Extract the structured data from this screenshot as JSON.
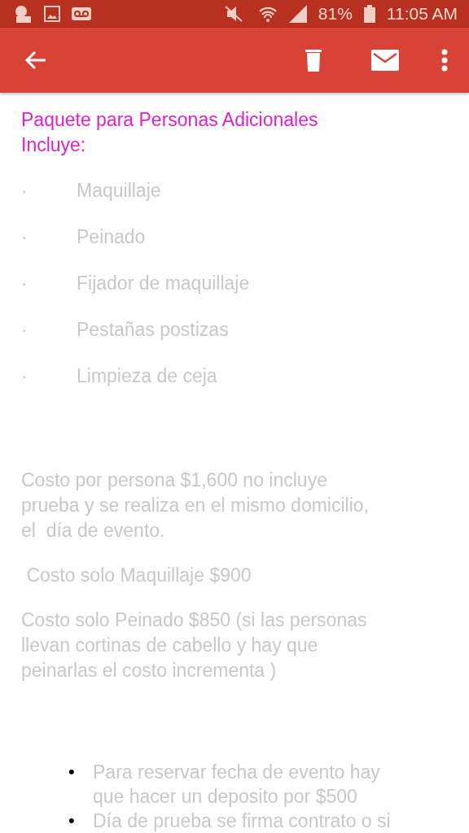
{
  "status_bar": {
    "battery_text": "81%",
    "time": "11:05 AM"
  },
  "toolbar": {
    "actions": [
      {
        "kind": "delete"
      },
      {
        "kind": "mail"
      },
      {
        "kind": "more"
      }
    ]
  },
  "email": {
    "heading": [
      "Paquete para Personas Adicionales",
      "Incluye:"
    ],
    "items": [
      {
        "marker": "·",
        "text": "Maquillaje"
      },
      {
        "marker": "·",
        "text": "Peinado"
      },
      {
        "marker": "·",
        "text": "Fijador de maquillaje"
      },
      {
        "marker": "·",
        "text": "Pestañas postizas"
      },
      {
        "marker": "·",
        "text": "Limpieza de ceja"
      }
    ],
    "paragraphs": [
      [
        "Costo por persona $1,600 no incluye",
        "prueba y se realiza en el mismo domicilio,",
        "el  día de evento."
      ],
      [
        " Costo solo Maquillaje $900"
      ],
      [
        "Costo solo Peinado $850 (si las personas",
        "llevan cortinas de cabello y hay que",
        "peinarlas el costo incrementa )"
      ]
    ],
    "bullets": [
      {
        "marker": "•",
        "lines": [
          "Para reservar fecha de evento hay",
          "que hacer un deposito por $500"
        ]
      },
      {
        "marker": "•",
        "lines": [
          "Día de prueba se firma contrato o si"
        ]
      }
    ]
  }
}
